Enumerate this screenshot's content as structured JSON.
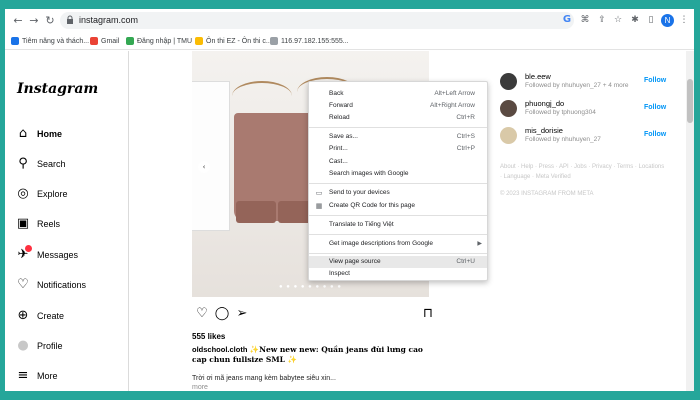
{
  "browser": {
    "url": "instagram.com",
    "nav": {
      "back": "←",
      "forward": "→",
      "reload": "↻"
    },
    "profile_initial": "N",
    "omnibox_icons": [
      "google-icon",
      "translate-icon",
      "share-icon",
      "bookmark-star-icon"
    ],
    "toolbar_icons": [
      "extensions-icon",
      "sidebar-icon"
    ]
  },
  "bookmarks": [
    {
      "label": "Tiêm năng và thách...",
      "color": "#1a73e8"
    },
    {
      "label": "Gmail",
      "color": "#ea4335"
    },
    {
      "label": "Đăng nhập | TMU",
      "color": "#34a853"
    },
    {
      "label": "Ôn thi EZ - Ôn thi c...",
      "color": "#fbbc04"
    },
    {
      "label": "116.97.182.155:555...",
      "color": "#9aa0a6"
    }
  ],
  "sidebar": {
    "logo": "Instagram",
    "items": [
      {
        "label": "Home",
        "icon": "⌂",
        "active": true
      },
      {
        "label": "Search",
        "icon": "⚲"
      },
      {
        "label": "Explore",
        "icon": "◎"
      },
      {
        "label": "Reels",
        "icon": "▣"
      },
      {
        "label": "Messages",
        "icon": "✈",
        "badge": true
      },
      {
        "label": "Notifications",
        "icon": "♡"
      },
      {
        "label": "Create",
        "icon": "⊕"
      },
      {
        "label": "Profile",
        "icon": "●"
      },
      {
        "label": "More",
        "icon": "≡"
      }
    ]
  },
  "post": {
    "likes": "555 likes",
    "username": "oldschool.cloth",
    "caption": "✨New new new: Quần jeans đùi lưng cao cap chun fullsize SML ✨",
    "subline": "Trời ơi mã jeans mang kèm babytee siêu xin...",
    "more": "more",
    "carousel_dots": "● ● ● ● ● ● ● ● ●"
  },
  "suggestions": [
    {
      "name": "ble.eew",
      "sub": "Followed by nhuhuyen_27 + 4 more",
      "follow": "Follow",
      "avatar": "#3b3b3b"
    },
    {
      "name": "phuongj_do",
      "sub": "Followed by tphuong304",
      "follow": "Follow",
      "avatar": "#5a4a42"
    },
    {
      "name": "mis_dorisie",
      "sub": "Followed by nhuhuyen_27",
      "follow": "Follow",
      "avatar": "#d9c9a8"
    }
  ],
  "footer": {
    "links": "About · Help · Press · API · Jobs · Privacy · Terms · Locations · Language · Meta Verified",
    "copyright": "© 2023 INSTAGRAM FROM META"
  },
  "context_menu": {
    "items": [
      {
        "label": "Back",
        "shortcut": "Alt+Left Arrow"
      },
      {
        "label": "Forward",
        "shortcut": "Alt+Right Arrow"
      },
      {
        "label": "Reload",
        "shortcut": "Ctrl+R"
      },
      {
        "label": "Save as...",
        "shortcut": "Ctrl+S"
      },
      {
        "label": "Print...",
        "shortcut": "Ctrl+P"
      },
      {
        "label": "Cast..."
      },
      {
        "label": "Search images with Google"
      },
      {
        "label": "Send to your devices",
        "icon": "devices-icon"
      },
      {
        "label": "Create QR Code for this page",
        "icon": "qr-code-icon"
      },
      {
        "label": "Translate to Tiếng Việt"
      },
      {
        "label": "Get image descriptions from Google",
        "submenu": true
      },
      {
        "label": "View page source",
        "shortcut": "Ctrl+U",
        "highlighted": true
      },
      {
        "label": "Inspect"
      }
    ]
  }
}
